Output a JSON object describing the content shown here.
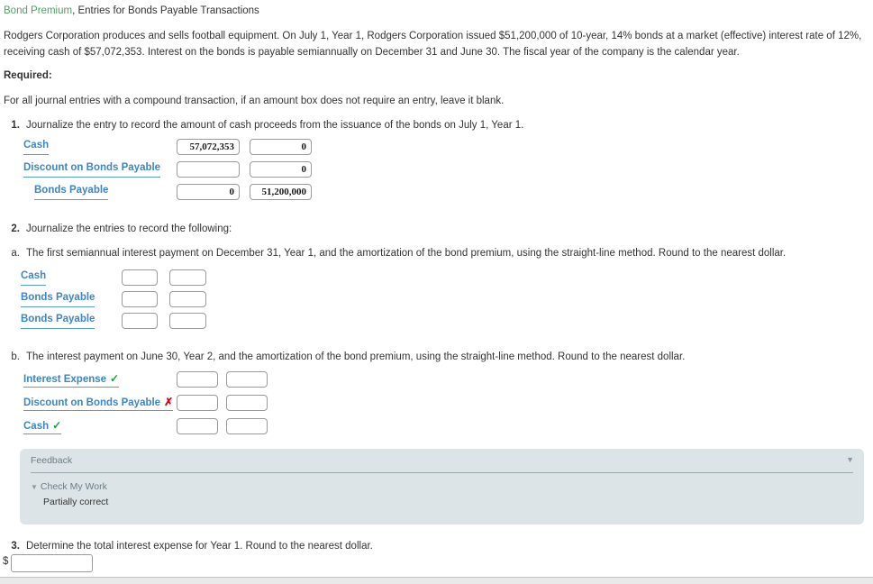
{
  "title": {
    "highlight": "Bond Premium",
    "rest": ", Entries for Bonds Payable Transactions"
  },
  "intro": "Rodgers Corporation produces and sells football equipment. On July 1, Year 1, Rodgers Corporation issued $51,200,000 of 10-year, 14% bonds at a market (effective) interest rate of 12%, receiving cash of $57,072,353. Interest on the bonds is payable semiannually on December 31 and June 30. The fiscal year of the company is the calendar year.",
  "required_label": "Required:",
  "blank_note": "For all journal entries with a compound transaction, if an amount box does not require an entry, leave it blank.",
  "questions": {
    "q1": {
      "number": "1.",
      "text": "Journalize the entry to record the amount of cash proceeds from the issuance of the bonds on July 1, Year 1."
    },
    "q2": {
      "number": "2.",
      "text": "Journalize the entries to record the following:"
    },
    "qa": {
      "number": "a.",
      "text": "The first semiannual interest payment on December 31, Year 1, and the amortization of the bond premium, using the straight-line method. Round to the nearest dollar."
    },
    "qb": {
      "number": "b.",
      "text": "The interest payment on June 30, Year 2, and the amortization of the bond premium, using the straight-line method. Round to the nearest dollar."
    },
    "q3": {
      "number": "3.",
      "text": "Determine the total interest expense for Year 1. Round to the nearest dollar."
    }
  },
  "table1": {
    "rows": [
      {
        "account": "Cash",
        "debit": "57,072,353",
        "credit": "0",
        "indent": false,
        "mark": ""
      },
      {
        "account": "Discount on Bonds Payable",
        "debit": "",
        "credit": "0",
        "indent": false,
        "mark": ""
      },
      {
        "account": "Bonds Payable",
        "debit": "0",
        "credit": "51,200,000",
        "indent": true,
        "mark": ""
      }
    ]
  },
  "table2a": {
    "rows": [
      {
        "account": "Cash",
        "debit": "",
        "credit": "",
        "mark": ""
      },
      {
        "account": "Bonds Payable",
        "debit": "",
        "credit": "",
        "mark": ""
      },
      {
        "account": "Bonds Payable",
        "debit": "",
        "credit": "",
        "mark": ""
      }
    ]
  },
  "table2b": {
    "rows": [
      {
        "account": "Interest Expense",
        "debit": "",
        "credit": "",
        "mark": "✓",
        "mark_type": "ok"
      },
      {
        "account": "Discount on Bonds Payable",
        "debit": "",
        "credit": "",
        "mark": "✗",
        "mark_type": "bad"
      },
      {
        "account": "Cash",
        "debit": "",
        "credit": "",
        "mark": "✓",
        "mark_type": "ok"
      }
    ]
  },
  "feedback": {
    "title": "Feedback",
    "collapse_icon": "▼",
    "check_my_work": "Check My Work",
    "check_my_work_caret": "▼",
    "result": "Partially correct"
  },
  "q3_answer": {
    "currency_symbol": "$",
    "value": "",
    "placeholder": ""
  },
  "colors": {
    "title_highlight": "#4aa564",
    "account_link": "#3d85c6",
    "correct": "#1a9f3d",
    "incorrect": "#d0021b",
    "feedback_bg": "#dce4e7"
  }
}
